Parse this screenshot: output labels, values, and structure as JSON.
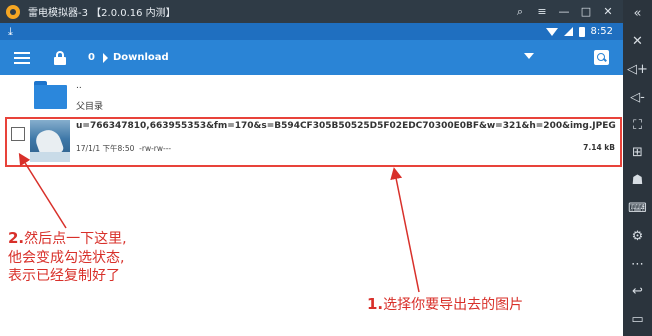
{
  "window": {
    "title": "雷电模拟器-3 【2.0.0.16 内测】"
  },
  "title_controls": [
    "⌕",
    "≡",
    "—",
    "□",
    "✕"
  ],
  "statusbar": {
    "time": "8:52"
  },
  "toolbar": {
    "tab_number": "0",
    "path": "Download"
  },
  "list": {
    "parent": {
      "dots": "..",
      "label": "父目录"
    },
    "file": {
      "name": "u=766347810,663955353&fm=170&s=B594CF305B50525D5F02EDC70300E0BF&w=321&h=200&img.JPEG",
      "date": "17/1/1 下午8:50",
      "permissions": "-rw-rw---",
      "size": "7.14 kB",
      "checked": false
    }
  },
  "annotations": {
    "step2": {
      "number": "2.",
      "line1": "然后点一下这里,",
      "line2": "他会变成勾选状态,",
      "line3": "表示已经复制好了"
    },
    "step1": {
      "number": "1.",
      "text": "选择你要导出去的图片"
    }
  },
  "colors": {
    "statusbar": "#1f6fc0",
    "toolbar": "#2a84d6",
    "folder": "#2b87dc",
    "annotation": "#d8302a"
  },
  "icons": {
    "sidebar": [
      "collapse-icon",
      "close-icon",
      "volume-up-icon",
      "volume-down-icon",
      "fullscreen-icon",
      "add-app-icon",
      "robot-icon",
      "keyboard-icon",
      "settings-icon",
      "more-icon",
      "back-icon",
      "recent-apps-icon"
    ]
  }
}
